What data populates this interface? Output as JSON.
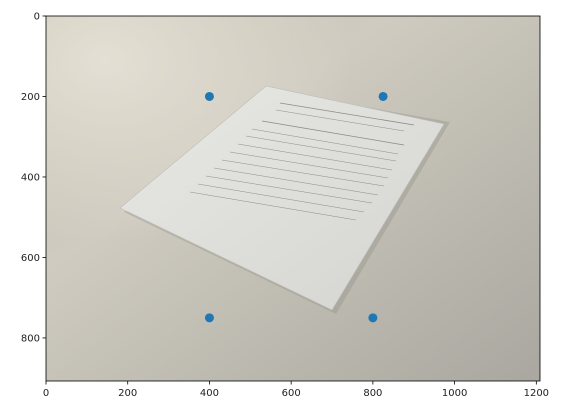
{
  "chart_data": {
    "type": "scatter",
    "title": "",
    "xlabel": "",
    "ylabel": "",
    "xlim": [
      0,
      1209
    ],
    "ylim": [
      907,
      0
    ],
    "x_ticks": [
      0,
      200,
      400,
      600,
      800,
      1000,
      1200
    ],
    "y_ticks": [
      0,
      200,
      400,
      600,
      800
    ],
    "background": "photo of a stapled paper document lying on a light gray table",
    "marker_color": "#1f77b4",
    "series": [
      {
        "x": [
          400,
          825,
          400,
          800
        ],
        "y": [
          200,
          200,
          750,
          750
        ]
      }
    ],
    "grid": false,
    "legend": "none"
  }
}
